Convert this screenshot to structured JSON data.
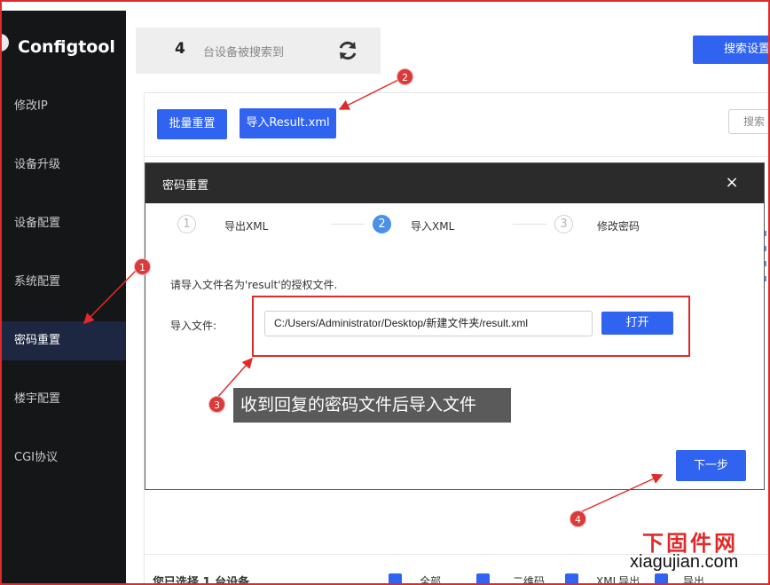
{
  "app": {
    "title": "Configtool"
  },
  "sidebar": {
    "items": [
      {
        "label": "修改IP"
      },
      {
        "label": "设备升级"
      },
      {
        "label": "设备配置"
      },
      {
        "label": "系统配置"
      },
      {
        "label": "密码重置"
      },
      {
        "label": "楼宇配置"
      },
      {
        "label": "CGI协议"
      }
    ],
    "active_index": 4
  },
  "header": {
    "device_count": "4",
    "device_text": "台设备被搜索到",
    "refresh_icon": "refresh-icon",
    "search_settings_label": "搜索设置"
  },
  "toolbar": {
    "batch_reset_label": "批量重置",
    "import_result_label": "导入Result.xml",
    "search_placeholder": "搜索"
  },
  "dialog": {
    "title": "密码重置",
    "close_symbol": "×",
    "steps": [
      {
        "num": "1",
        "label": "导出XML",
        "state": "inactive"
      },
      {
        "num": "2",
        "label": "导入XML",
        "state": "active"
      },
      {
        "num": "3",
        "label": "修改密码",
        "state": "inactive"
      }
    ],
    "hint": "请导入文件名为'result'的授权文件.",
    "import_label": "导入文件:",
    "file_path": "C:/Users/Administrator/Desktop/新建文件夹/result.xml",
    "open_label": "打开",
    "next_label": "下一步"
  },
  "annotations": {
    "callout_text": "收到回复的密码文件后导入文件",
    "badges": [
      "1",
      "2",
      "3",
      "4"
    ],
    "color": "#e02a2a"
  },
  "bottom": {
    "selected_text": "您已选择 1 台设备",
    "checkboxes": [
      {
        "label": "全部"
      },
      {
        "label": "二维码"
      },
      {
        "label": "XML导出"
      },
      {
        "label": "导出"
      }
    ]
  },
  "watermark": {
    "cn": "下固件网",
    "en": "xiagujian.com"
  },
  "colors": {
    "primary": "#2f63f0",
    "sidebar_bg": "#151618",
    "sidebar_active": "#1d2742",
    "step_active": "#4a8fe8"
  }
}
